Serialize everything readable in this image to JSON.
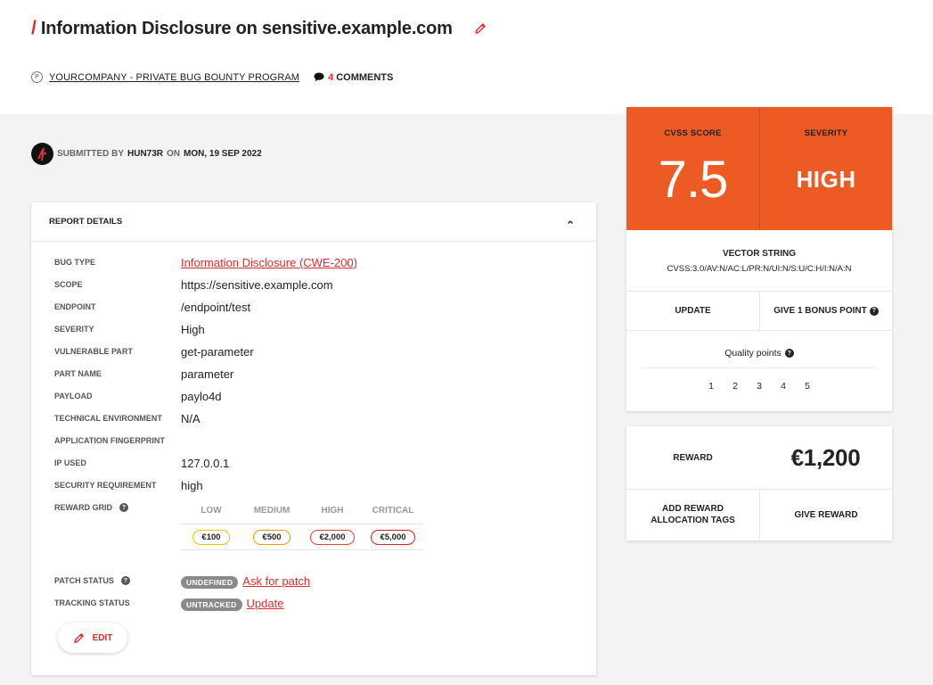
{
  "header": {
    "title_slash": "/",
    "title": "Information Disclosure on sensitive.example.com",
    "program_badge": "P",
    "program_name": "YOURCOMPANY - PRIVATE BUG BOUNTY PROGRAM",
    "comments_count": "4",
    "comments_label": "COMMENTS"
  },
  "submitted": {
    "prefix": "SUBMITTED BY",
    "user": "HUN73R",
    "on": "ON",
    "date": "MON, 19 SEP 2022"
  },
  "details": {
    "heading": "REPORT DETAILS",
    "rows": [
      {
        "label": "BUG TYPE",
        "value": "Information Disclosure (CWE-200)"
      },
      {
        "label": "SCOPE",
        "value": "https://sensitive.example.com"
      },
      {
        "label": "ENDPOINT",
        "value": "/endpoint/test"
      },
      {
        "label": "SEVERITY",
        "value": "High"
      },
      {
        "label": "VULNERABLE PART",
        "value": "get-parameter"
      },
      {
        "label": "PART NAME",
        "value": "parameter"
      },
      {
        "label": "PAYLOAD",
        "value": "paylo4d"
      },
      {
        "label": "TECHNICAL ENVIRONMENT",
        "value": "N/A"
      },
      {
        "label": "APPLICATION FINGERPRINT",
        "value": ""
      },
      {
        "label": "IP USED",
        "value": "127.0.0.1"
      },
      {
        "label": "SECURITY REQUIREMENT",
        "value": "high"
      },
      {
        "label": "REWARD GRID",
        "value": ""
      }
    ],
    "reward_grid": {
      "headers": [
        "LOW",
        "MEDIUM",
        "HIGH",
        "CRITICAL"
      ],
      "values": [
        "€100",
        "€500",
        "€2,000",
        "€5,000"
      ],
      "colors": [
        "#f2c200",
        "#f29b00",
        "#e04a2a",
        "#d81e1e"
      ]
    },
    "patch_status": {
      "label": "PATCH STATUS",
      "badge": "UNDEFINED",
      "link": "Ask for patch"
    },
    "tracking_status": {
      "label": "TRACKING STATUS",
      "badge": "UNTRACKED",
      "link": "Update"
    },
    "edit_label": "EDIT"
  },
  "score": {
    "cvss_label": "CVSS SCORE",
    "cvss_value": "7.5",
    "severity_label": "SEVERITY",
    "severity_value": "HIGH",
    "vector_label": "VECTOR STRING",
    "vector_value": "CVSS:3.0/AV:N/AC:L/PR:N/UI:N/S:U/C:H/I:N/A:N",
    "update_label": "UPDATE",
    "bonus_label": "GIVE 1 BONUS POINT",
    "quality_label": "Quality points",
    "quality_options": [
      "1",
      "2",
      "3",
      "4",
      "5"
    ],
    "accent_color": "#ee5a24"
  },
  "reward": {
    "label": "REWARD",
    "value": "€1,200",
    "allocation_label": "ADD REWARD ALLOCATION TAGS",
    "give_label": "GIVE REWARD"
  },
  "icons": {
    "title_edit": "pencil-icon",
    "comment": "speech-bubble-icon",
    "collapse": "chevron-up-icon",
    "help": "question-circle-icon"
  }
}
